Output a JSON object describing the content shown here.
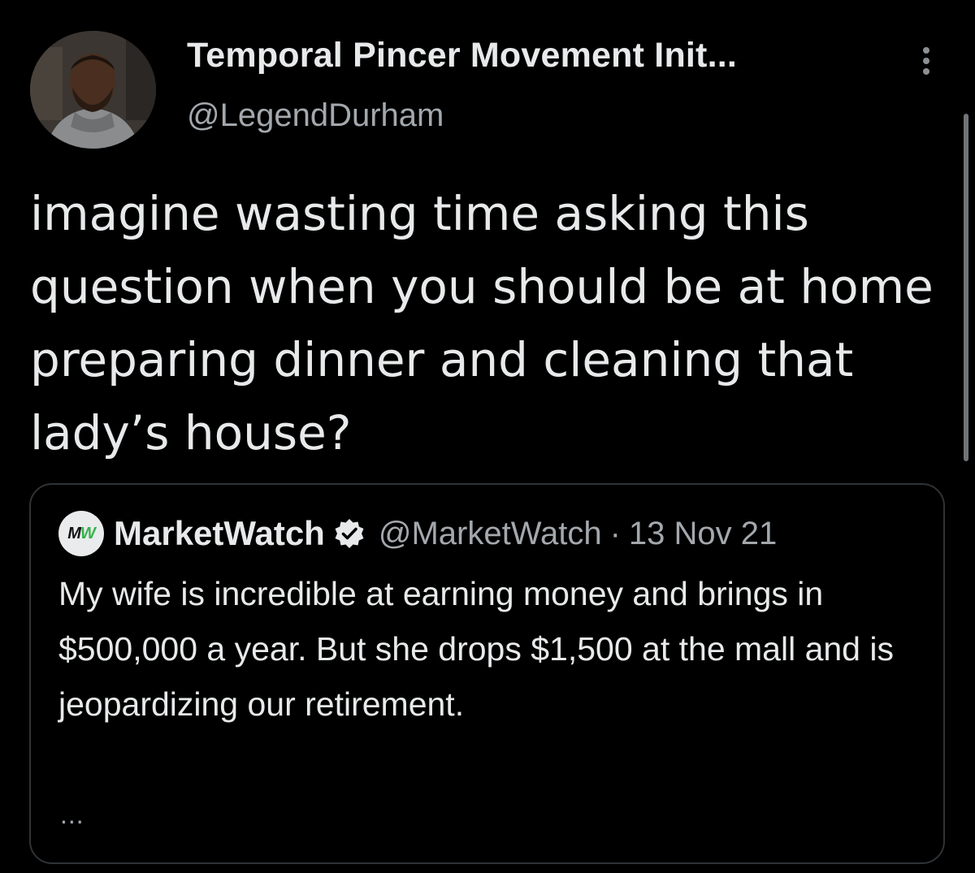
{
  "tweet": {
    "author": {
      "display_name": "Temporal Pincer Movement Init...",
      "handle": "@LegendDurham",
      "avatar_icon": "profile-photo"
    },
    "more_icon": "more-vertical-icon",
    "text": "imagine wasting time asking this question when you should be at home preparing dinner and cleaning that lady’s house?"
  },
  "quoted_tweet": {
    "avatar_text_m": "M",
    "avatar_text_w": "W",
    "name": "MarketWatch",
    "verified_icon": "verified-badge-icon",
    "handle": "@MarketWatch",
    "separator": "·",
    "date": "13 Nov 21",
    "text": "My wife is incredible at earning money and brings in $500,000 a year. But she drops $1,500 at the mall and is jeopardizing our retirement.",
    "ellipsis": "..."
  },
  "colors": {
    "background": "#000000",
    "primary_text": "#e7e9ea",
    "secondary_text": "#a3a8ad",
    "card_border": "#2f3336",
    "marketwatch_green": "#35b34a"
  }
}
